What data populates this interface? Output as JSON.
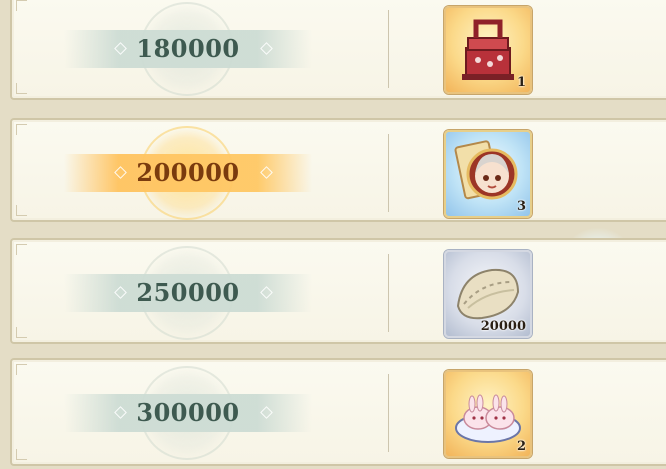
{
  "tiers": [
    {
      "amount": "180000",
      "highlighted": false,
      "reward": {
        "icon": "lunch-box-icon",
        "quantity": "1",
        "frame": "orange"
      }
    },
    {
      "amount": "200000",
      "highlighted": true,
      "reward": {
        "icon": "character-portrait-icon",
        "quantity": "3",
        "frame": "blue"
      }
    },
    {
      "amount": "250000",
      "highlighted": false,
      "reward": {
        "icon": "dumpling-icon",
        "quantity": "20000",
        "frame": "grey"
      }
    },
    {
      "amount": "300000",
      "highlighted": false,
      "reward": {
        "icon": "bunny-buns-icon",
        "quantity": "2",
        "frame": "orange"
      }
    }
  ],
  "colors": {
    "highlight": "#f7b65a",
    "normal_band": "#cddcd4",
    "amount_text": "#3e5a50",
    "amount_text_highlight": "#7a3b0e"
  }
}
